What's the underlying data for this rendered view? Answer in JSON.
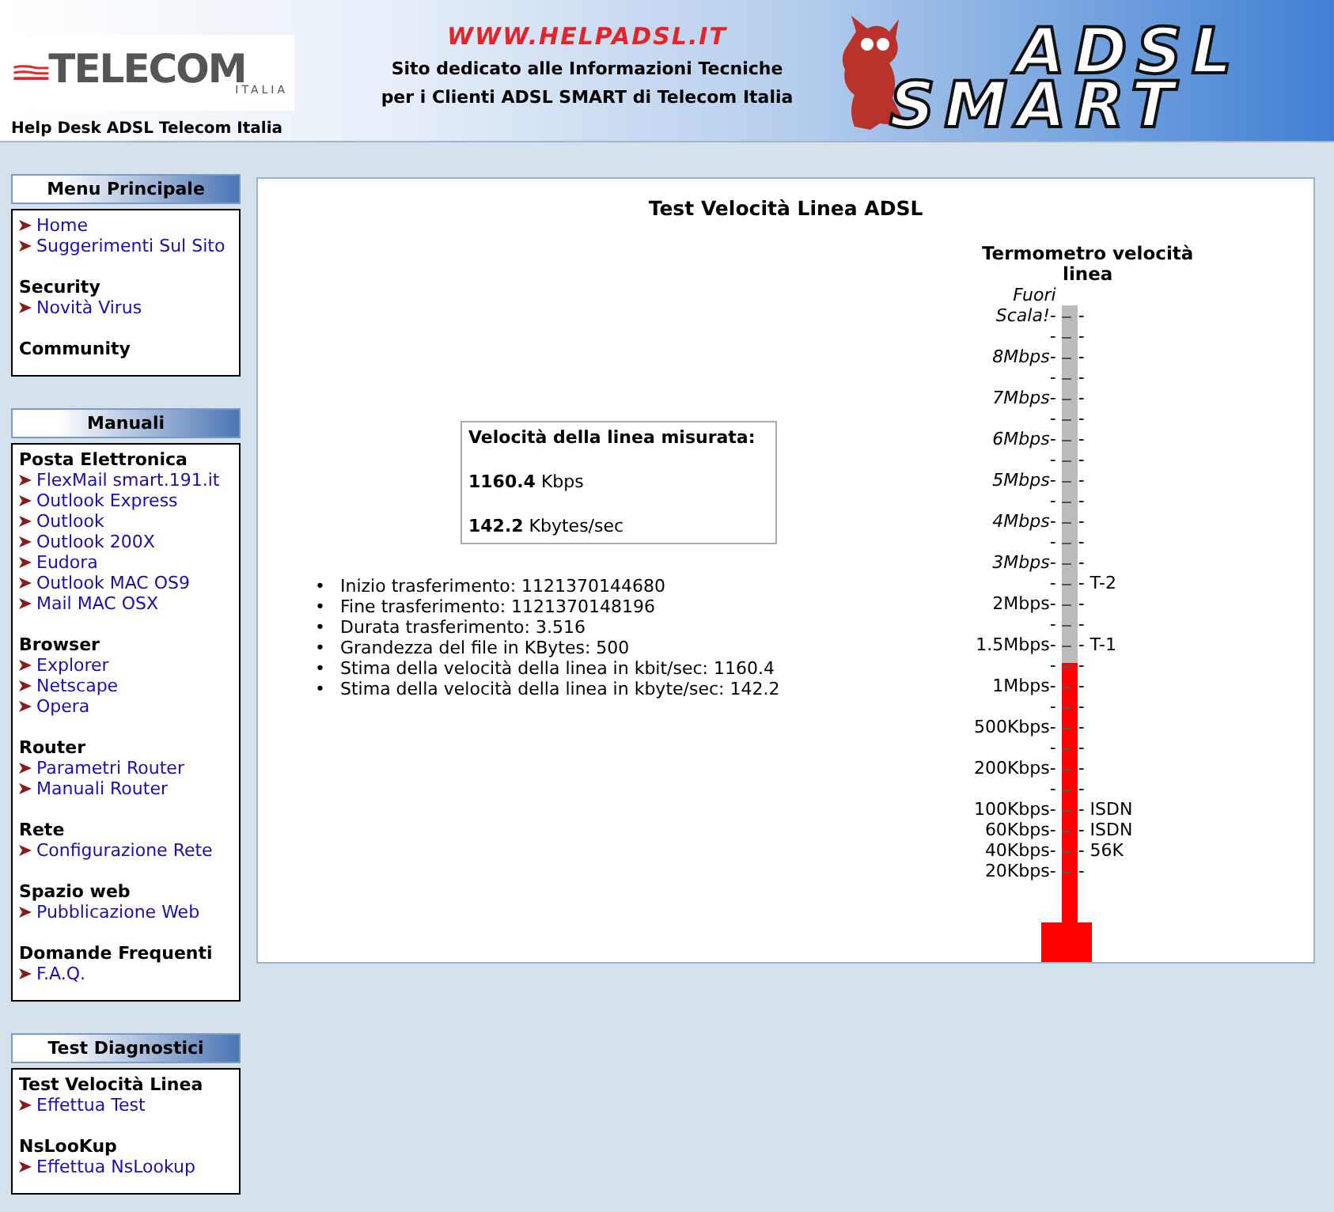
{
  "header": {
    "logo_text": "TELECOM",
    "logo_subtext": "ITALIA",
    "helpdesk": "Help Desk ADSL Telecom Italia",
    "site_url": "WWW.HELPADSL.IT",
    "tagline": [
      "Sito dedicato alle Informazioni Tecniche",
      "per i Clienti ADSL SMART di Telecom Italia"
    ],
    "banner_text": [
      "ADSL",
      "SMART"
    ]
  },
  "sidebar": [
    {
      "title": "Menu Principale",
      "groups": [
        {
          "links": [
            "Home",
            "Suggerimenti Sul Sito"
          ]
        },
        {
          "heading": "Security",
          "links": [
            "Novità Virus"
          ]
        },
        {
          "heading": "Community"
        }
      ]
    },
    {
      "title": "Manuali",
      "groups": [
        {
          "heading": "Posta Elettronica",
          "links": [
            "FlexMail smart.191.it",
            "Outlook Express",
            "Outlook",
            "Outlook 200X",
            "Eudora",
            "Outlook MAC OS9",
            "Mail MAC OSX"
          ]
        },
        {
          "heading": "Browser",
          "links": [
            "Explorer",
            "Netscape",
            "Opera"
          ]
        },
        {
          "heading": "Router",
          "links": [
            "Parametri Router",
            "Manuali Router"
          ]
        },
        {
          "heading": "Rete",
          "links": [
            "Configurazione Rete"
          ]
        },
        {
          "heading": "Spazio web",
          "links": [
            "Pubblicazione Web"
          ]
        },
        {
          "heading": "Domande Frequenti",
          "links": [
            "F.A.Q."
          ]
        }
      ]
    },
    {
      "title": "Test Diagnostici",
      "groups": [
        {
          "heading": "Test Velocità Linea",
          "links": [
            "Effettua Test"
          ]
        },
        {
          "heading": "NsLooKup",
          "links": [
            "Effettua NsLookup"
          ]
        }
      ]
    }
  ],
  "main": {
    "title": "Test Velocità Linea ADSL",
    "result": {
      "heading": "Velocità della linea misurata:",
      "lines": [
        "**1160.4** Kbps",
        "**142.2** Kbytes/sec"
      ]
    },
    "details": [
      {
        "bullet": "•",
        "text": "Inizio trasferimento: 1121370144680"
      },
      {
        "bullet": "•",
        "text": "Fine trasferimento: 1121370148196"
      },
      {
        "bullet": "•",
        "text": "Durata trasferimento: 3.516"
      },
      {
        "bullet": "•",
        "text": "Grandezza del file in KBytes: 500"
      },
      {
        "bullet": "•",
        "text": "Stima della velocità della linea in kbit/sec: 1160.4"
      },
      {
        "bullet": "•",
        "text": "Stima della velocità della linea in kbyte/sec: 142.2"
      }
    ],
    "thermometer": {
      "title": "Termometro velocità linea",
      "level": 0.42,
      "scale": [
        {
          "left": "Fuori",
          "italic": true,
          "tick": false
        },
        {
          "left": "Scala!-",
          "right": "-",
          "italic": true,
          "tick": true
        },
        {
          "left": "-",
          "right": "-",
          "italic": false,
          "tick": true
        },
        {
          "left": "8Mbps-",
          "right": "-",
          "italic": true,
          "tick": true
        },
        {
          "left": "-",
          "right": "-",
          "italic": false,
          "tick": true
        },
        {
          "left": "7Mbps-",
          "right": "-",
          "italic": true,
          "tick": true
        },
        {
          "left": "-",
          "right": "-",
          "italic": false,
          "tick": true
        },
        {
          "left": "6Mbps-",
          "right": "-",
          "italic": true,
          "tick": true
        },
        {
          "left": "-",
          "right": "-",
          "italic": false,
          "tick": true
        },
        {
          "left": "5Mbps-",
          "right": "-",
          "italic": true,
          "tick": true
        },
        {
          "left": "-",
          "right": "-",
          "italic": false,
          "tick": true
        },
        {
          "left": "4Mbps-",
          "right": "-",
          "italic": true,
          "tick": true
        },
        {
          "left": "-",
          "right": "-",
          "italic": false,
          "tick": true
        },
        {
          "left": "3Mbps-",
          "right": "-",
          "italic": true,
          "tick": true
        },
        {
          "left": "-",
          "right": "- T-2",
          "italic": false,
          "tick": true
        },
        {
          "left": "2Mbps-",
          "right": "-",
          "italic": false,
          "tick": true
        },
        {
          "left": "-",
          "right": "-",
          "italic": false,
          "tick": true
        },
        {
          "left": "1.5Mbps-",
          "right": "- T-1",
          "italic": false,
          "tick": true
        },
        {
          "left": "-",
          "right": "-",
          "italic": false,
          "tick": true
        },
        {
          "left": "1Mbps-",
          "right": "-",
          "italic": false,
          "tick": true
        },
        {
          "left": "-",
          "right": "-",
          "italic": false,
          "tick": true
        },
        {
          "left": "500Kbps-",
          "right": "-",
          "italic": false,
          "tick": true
        },
        {
          "left": "-",
          "right": "-",
          "italic": false,
          "tick": true
        },
        {
          "left": "200Kbps-",
          "right": "-",
          "italic": false,
          "tick": true
        },
        {
          "left": "-",
          "right": "-",
          "italic": false,
          "tick": true
        },
        {
          "left": "100Kbps-",
          "right": "- ISDN",
          "italic": false,
          "tick": true
        },
        {
          "left": "60Kbps-",
          "right": "- ISDN",
          "italic": false,
          "tick": true
        },
        {
          "left": "40Kbps-",
          "right": "- 56K",
          "italic": false,
          "tick": true
        },
        {
          "left": "20Kbps-",
          "right": "-",
          "italic": false,
          "tick": true
        }
      ]
    }
  }
}
